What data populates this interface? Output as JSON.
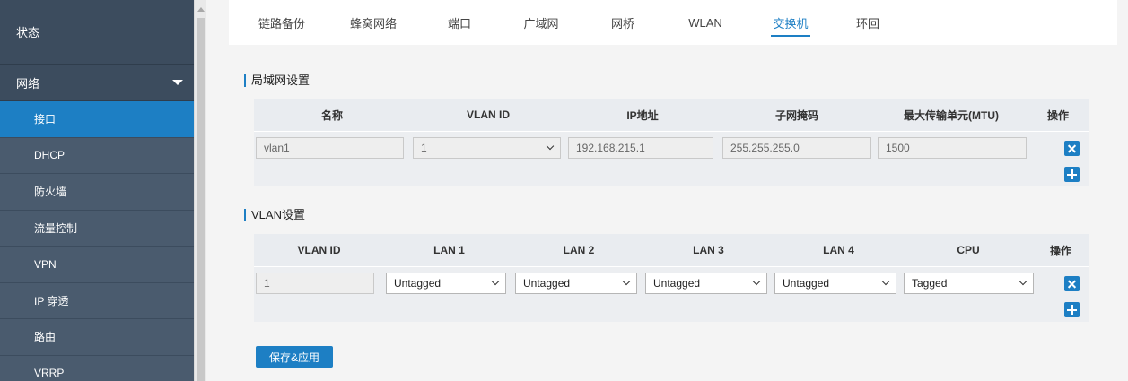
{
  "sidebar": {
    "status_label": "状态",
    "network_label": "网络",
    "items": [
      {
        "label": "接口",
        "active": true
      },
      {
        "label": "DHCP"
      },
      {
        "label": "防火墙"
      },
      {
        "label": "流量控制"
      },
      {
        "label": "VPN"
      },
      {
        "label": "IP 穿透"
      },
      {
        "label": "路由"
      },
      {
        "label": "VRRP"
      }
    ]
  },
  "tabs": [
    {
      "label": "链路备份"
    },
    {
      "label": "蜂窝网络"
    },
    {
      "label": "端口"
    },
    {
      "label": "广域网"
    },
    {
      "label": "网桥"
    },
    {
      "label": "WLAN"
    },
    {
      "label": "交换机",
      "active": true
    },
    {
      "label": "环回"
    }
  ],
  "lan_section": {
    "title": "局域网设置",
    "headers": {
      "name": "名称",
      "vlan_id": "VLAN ID",
      "ip": "IP地址",
      "mask": "子网掩码",
      "mtu": "最大传输单元(MTU)",
      "action": "操作"
    },
    "row": {
      "name": "vlan1",
      "vlan_id": "1",
      "ip": "192.168.215.1",
      "mask": "255.255.255.0",
      "mtu": "1500"
    }
  },
  "vlan_section": {
    "title": "VLAN设置",
    "headers": {
      "vlan_id": "VLAN ID",
      "lan1": "LAN 1",
      "lan2": "LAN 2",
      "lan3": "LAN 3",
      "lan4": "LAN 4",
      "cpu": "CPU",
      "action": "操作"
    },
    "row": {
      "vlan_id": "1",
      "lan1": "Untagged",
      "lan2": "Untagged",
      "lan3": "Untagged",
      "lan4": "Untagged",
      "cpu": "Tagged"
    }
  },
  "actions": {
    "save_label": "保存&应用"
  },
  "colors": {
    "accent": "#1d7fc4",
    "sidebar": "#3c4c5e",
    "sidebar_sub": "#4a5b6e"
  }
}
